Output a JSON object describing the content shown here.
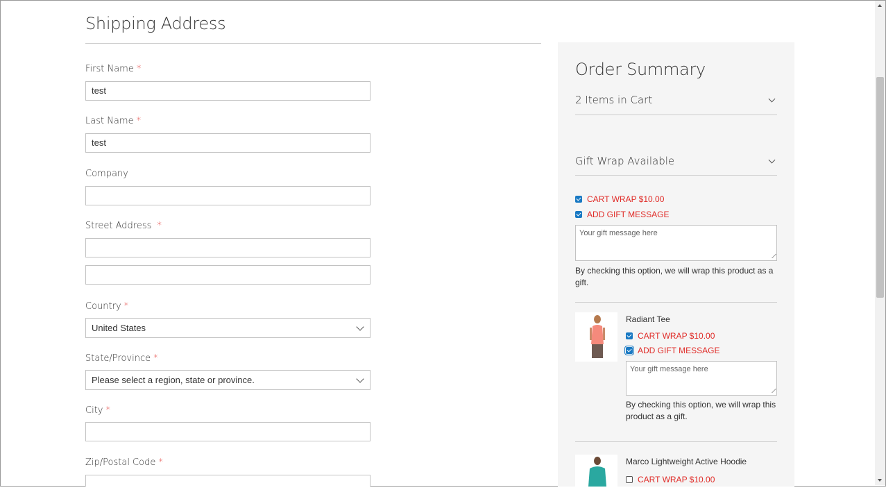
{
  "shipping": {
    "title": "Shipping Address",
    "first_name": {
      "label": "First Name",
      "value": "test"
    },
    "last_name": {
      "label": "Last Name",
      "value": "test"
    },
    "company": {
      "label": "Company",
      "value": ""
    },
    "street": {
      "label": "Street Address",
      "line1": "",
      "line2": ""
    },
    "country": {
      "label": "Country",
      "value": "United States"
    },
    "state": {
      "label": "State/Province",
      "value": "Please select a region, state or province."
    },
    "city": {
      "label": "City",
      "value": ""
    },
    "zip": {
      "label": "Zip/Postal Code",
      "value": ""
    },
    "required_mark": "*"
  },
  "summary": {
    "title": "Order Summary",
    "items_in_cart": "2 Items in Cart",
    "gift_wrap_title": "Gift Wrap Available",
    "cart_wrap_label": "CART WRAP $10.00",
    "add_gift_message_label": "ADD GIFT MESSAGE",
    "gift_placeholder": "Your gift message here",
    "wrap_note": "By checking this option, we will wrap this product as a gift.",
    "products": [
      {
        "name": "Radiant Tee",
        "cart_wrap_label": "CART WRAP $10.00",
        "cart_wrap_checked": true,
        "gift_message_label": "ADD GIFT MESSAGE",
        "gift_message_checked": true,
        "gift_placeholder": "Your gift message here",
        "note": "By checking this option, we will wrap this product as a gift."
      },
      {
        "name": "Marco Lightweight Active Hoodie",
        "cart_wrap_label": "CART WRAP $10.00",
        "cart_wrap_checked": false
      }
    ]
  },
  "colors": {
    "required": "#e02b27",
    "option_text": "#e02b27",
    "checkbox": "#1979c3",
    "summary_bg": "#f5f5f5"
  },
  "icons": [
    "chevron-down-icon",
    "checkbox-checked-icon",
    "checkbox-unchecked-icon",
    "resize-grip-icon",
    "scroll-up-icon",
    "scroll-down-icon"
  ]
}
